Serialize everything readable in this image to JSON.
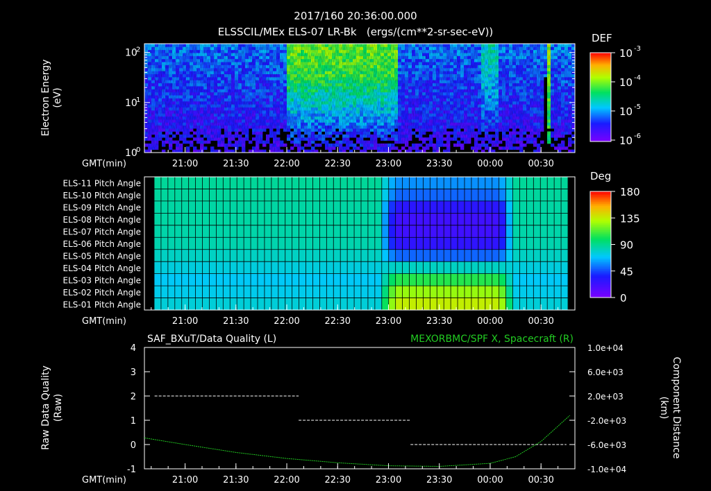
{
  "header": {
    "title": "2017/160 20:36:00.000",
    "subtitle": "ELSSCIL/MEx ELS-07 LR-Bk   (ergs/(cm**2-sr-sec-eV))"
  },
  "colors": {
    "background": "#000000",
    "foreground": "#ffffff",
    "right_axis": "#22cc22"
  },
  "time_axis": {
    "label": "GMT(min)",
    "ticks": [
      "21:00",
      "21:30",
      "22:00",
      "22:30",
      "23:00",
      "23:30",
      "00:00",
      "00:30"
    ]
  },
  "chart_data": [
    {
      "type": "heatmap",
      "ylabel": "Electron Energy\n(eV)",
      "y_scale": "log",
      "ylim": [
        1,
        150
      ],
      "y_ticks": [
        "10",
        "10",
        "10"
      ],
      "y_tick_exponents": [
        "2",
        "1",
        "0"
      ],
      "x": "time",
      "colorbar": {
        "title": "DEF",
        "scale": "log",
        "ticks": [
          "10",
          "10",
          "10",
          "10"
        ],
        "tick_exponents": [
          "-3",
          "-4",
          "-5",
          "-6"
        ]
      }
    },
    {
      "type": "heatmap",
      "rows": [
        "ELS-11 Pitch Angle",
        "ELS-10 Pitch Angle",
        "ELS-09 Pitch Angle",
        "ELS-08 Pitch Angle",
        "ELS-07 Pitch Angle",
        "ELS-06 Pitch Angle",
        "ELS-05 Pitch Angle",
        "ELS-04 Pitch Angle",
        "ELS-03 Pitch Angle",
        "ELS-02 Pitch Angle",
        "ELS-01 Pitch Angle"
      ],
      "pitch_angle_deg_outside_event": [
        88,
        87,
        86,
        86,
        85,
        84,
        80,
        75,
        70,
        72,
        76
      ],
      "pitch_angle_deg_during_event": [
        58,
        50,
        30,
        22,
        22,
        28,
        50,
        80,
        105,
        125,
        135
      ],
      "event_start": "23:00",
      "event_end": "00:10",
      "colorbar": {
        "title": "Deg",
        "ticks": [
          "180",
          "135",
          "90",
          "45",
          "0"
        ],
        "range": [
          0,
          180
        ]
      }
    },
    {
      "type": "line",
      "title_left": "SAF_BXuT/Data Quality (L)",
      "title_right": "MEXORBMC/SPF X, Spacecraft (R)",
      "ylabel_left": "Raw Data Quality\n(Raw)",
      "ylabel_right": "Component Distance\n(km)",
      "ylim_left": [
        -1,
        4
      ],
      "ylim_right": [
        -10000,
        10000
      ],
      "left_ticks": [
        "4",
        "3",
        "2",
        "1",
        "0",
        "-1"
      ],
      "right_ticks": [
        "1.0e+04",
        "6.0e+03",
        "2.0e+03",
        "-2.0e+03",
        "-6.0e+03",
        "-1.0e+04"
      ],
      "series": [
        {
          "axis": "left",
          "style": "dashed",
          "segments": [
            {
              "start": "20:42",
              "end": "22:07",
              "value": 2
            },
            {
              "start": "22:07",
              "end": "23:13",
              "value": 1
            },
            {
              "start": "23:13",
              "end": "00:45",
              "value": 0
            }
          ]
        },
        {
          "axis": "right",
          "x": [
            "20:36",
            "21:00",
            "21:30",
            "22:00",
            "22:30",
            "23:00",
            "23:30",
            "00:00",
            "00:15",
            "00:30",
            "00:47"
          ],
          "values": [
            -4900,
            -6000,
            -7300,
            -8300,
            -9000,
            -9500,
            -9600,
            -9100,
            -8000,
            -5500,
            -1200
          ]
        }
      ]
    }
  ]
}
